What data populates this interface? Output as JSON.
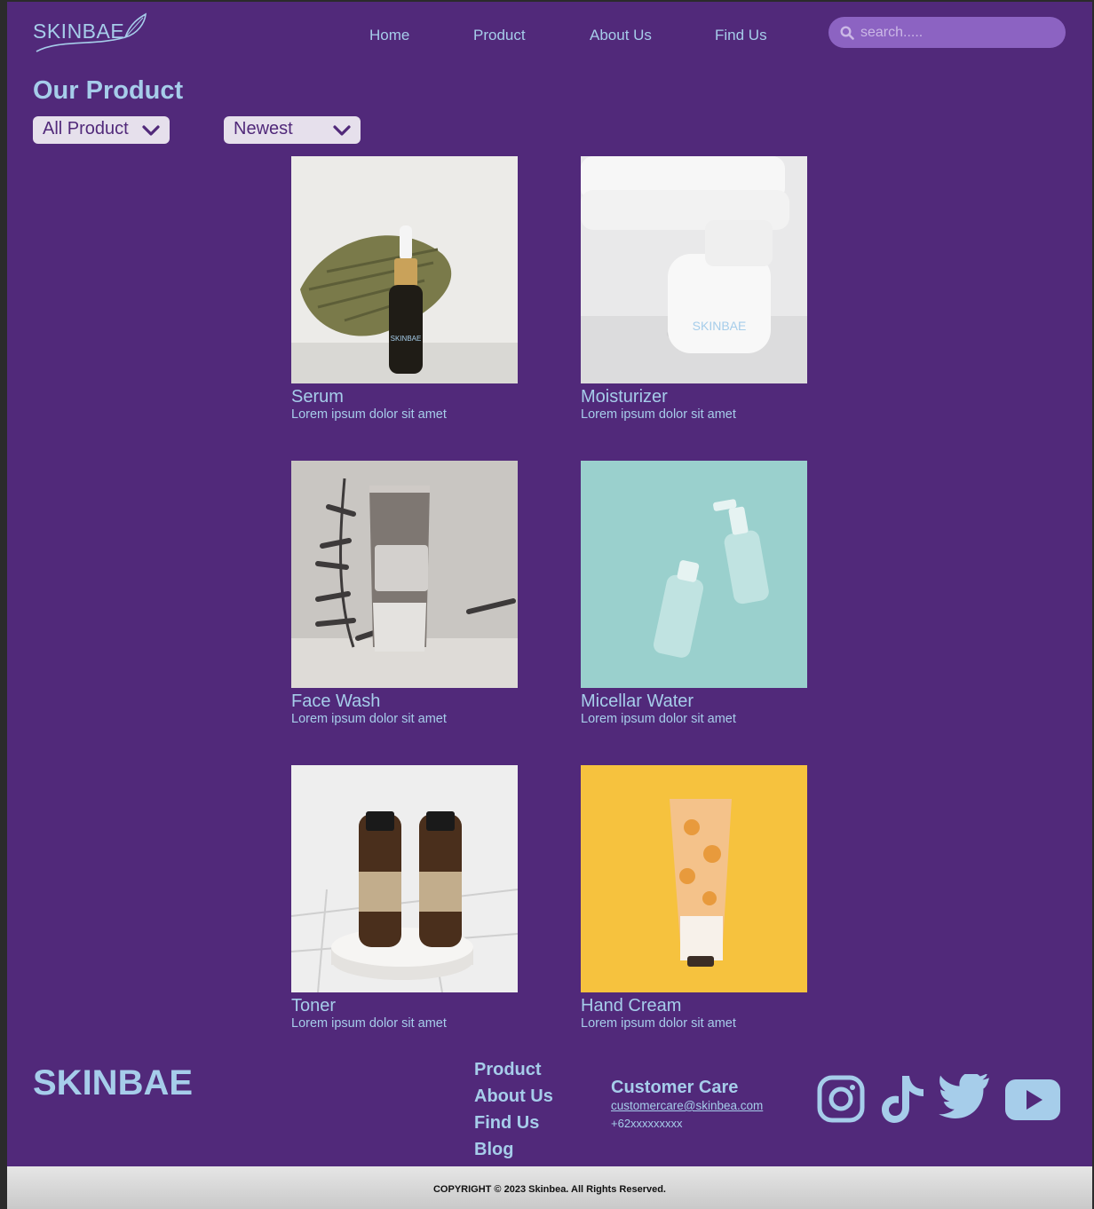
{
  "header": {
    "logo_text": "SKINBAE",
    "nav": [
      "Home",
      "Product",
      "About Us",
      "Find Us"
    ],
    "search_placeholder": "search....."
  },
  "main": {
    "title": "Our Product",
    "filter_category": "All Product",
    "filter_sort": "Newest"
  },
  "products": [
    {
      "name": "Serum",
      "desc": "Lorem ipsum dolor sit amet"
    },
    {
      "name": "Moisturizer",
      "desc": "Lorem ipsum dolor sit amet"
    },
    {
      "name": "Face Wash",
      "desc": "Lorem ipsum dolor sit amet"
    },
    {
      "name": "Micellar Water",
      "desc": "Lorem ipsum dolor sit amet"
    },
    {
      "name": "Toner",
      "desc": "Lorem ipsum dolor sit amet"
    },
    {
      "name": "Hand Cream",
      "desc": "Lorem ipsum dolor sit amet"
    }
  ],
  "footer": {
    "brand": "SKINBAE",
    "links": [
      "Product",
      "About Us",
      "Find Us",
      "Blog"
    ],
    "customer_care_title": "Customer Care",
    "email": "customercare@skinbea.com",
    "phone": "+62xxxxxxxxx",
    "social_icons": [
      "instagram-icon",
      "tiktok-icon",
      "twitter-icon",
      "youtube-icon"
    ],
    "copyright": "COPYRIGHT © 2023 Skinbea. All Rights Reserved."
  },
  "colors": {
    "background": "#51297a",
    "accent": "#a6cdea",
    "search_bg": "#8c63c2",
    "dropdown_bg": "#e6e0ec"
  }
}
